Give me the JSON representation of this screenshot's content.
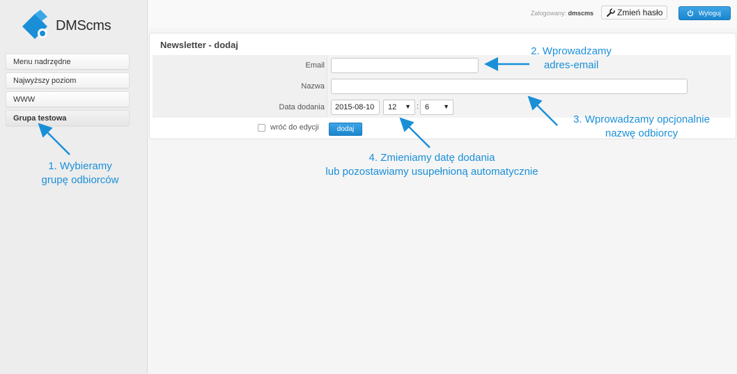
{
  "app": {
    "logo_text": "DMScms"
  },
  "sidebar": {
    "items": [
      {
        "label": "Menu nadrzędne"
      },
      {
        "label": "Najwyższy poziom"
      },
      {
        "label": "WWW"
      },
      {
        "label": "Grupa testowa"
      }
    ]
  },
  "topbar": {
    "logged_prefix": "Zalogowany:",
    "username": "dmscms",
    "change_password_label": "Zmień hasło",
    "logout_label": "Wyloguj"
  },
  "form": {
    "title": "Newsletter - dodaj",
    "email_label": "Email",
    "email_value": "",
    "name_label": "Nazwa",
    "name_value": "",
    "date_label": "Data dodania",
    "date_value": "2015-08-10",
    "hour_value": "12",
    "minute_value": "6",
    "time_separator": ":",
    "return_checkbox_label": "wróć do edycji",
    "return_checked": false,
    "submit_label": "dodaj"
  },
  "annotations": {
    "a1_line1": "1. Wybieramy",
    "a1_line2": "grupę odbiorców",
    "a2_line1": "2. Wprowadzamy",
    "a2_line2": "adres-email",
    "a3_line1": "3. Wprowadzamy opcjonalnie",
    "a3_line2": "nazwę odbiorcy",
    "a4_line1": "4. Zmieniamy datę dodania",
    "a4_line2": "lub pozostawiamy usupełnioną automatycznie",
    "color": "#1a8fd8"
  },
  "colors": {
    "accent": "#1a86cf",
    "sidebar_bg": "#ededed",
    "page_bg": "#f5f5f5"
  }
}
